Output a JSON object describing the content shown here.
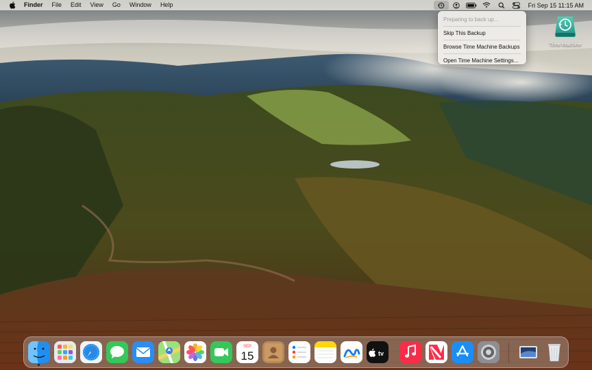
{
  "menubar": {
    "app_name": "Finder",
    "menus": [
      "File",
      "Edit",
      "View",
      "Go",
      "Window",
      "Help"
    ],
    "clock": "Fri Sep 15  11:15 AM"
  },
  "time_machine_menu": {
    "status": "Preparing to back up...",
    "items": [
      "Skip This Backup",
      "Browse Time Machine Backups",
      "Open Time Machine Settings..."
    ]
  },
  "desktop": {
    "icons": [
      {
        "label": "Time Machine",
        "icon": "time-machine-icon"
      }
    ]
  },
  "dock": {
    "apps": [
      "Finder",
      "Launchpad",
      "Safari",
      "Messages",
      "Mail",
      "Maps",
      "Photos",
      "FaceTime",
      "Calendar",
      "Contacts",
      "Reminders",
      "Notes",
      "Freeform",
      "TV",
      "Music",
      "News",
      "App Store",
      "System Settings",
      "Downloads",
      "Trash"
    ],
    "calendar": {
      "month": "SEP",
      "day": "15"
    },
    "tv_label": "tv"
  }
}
